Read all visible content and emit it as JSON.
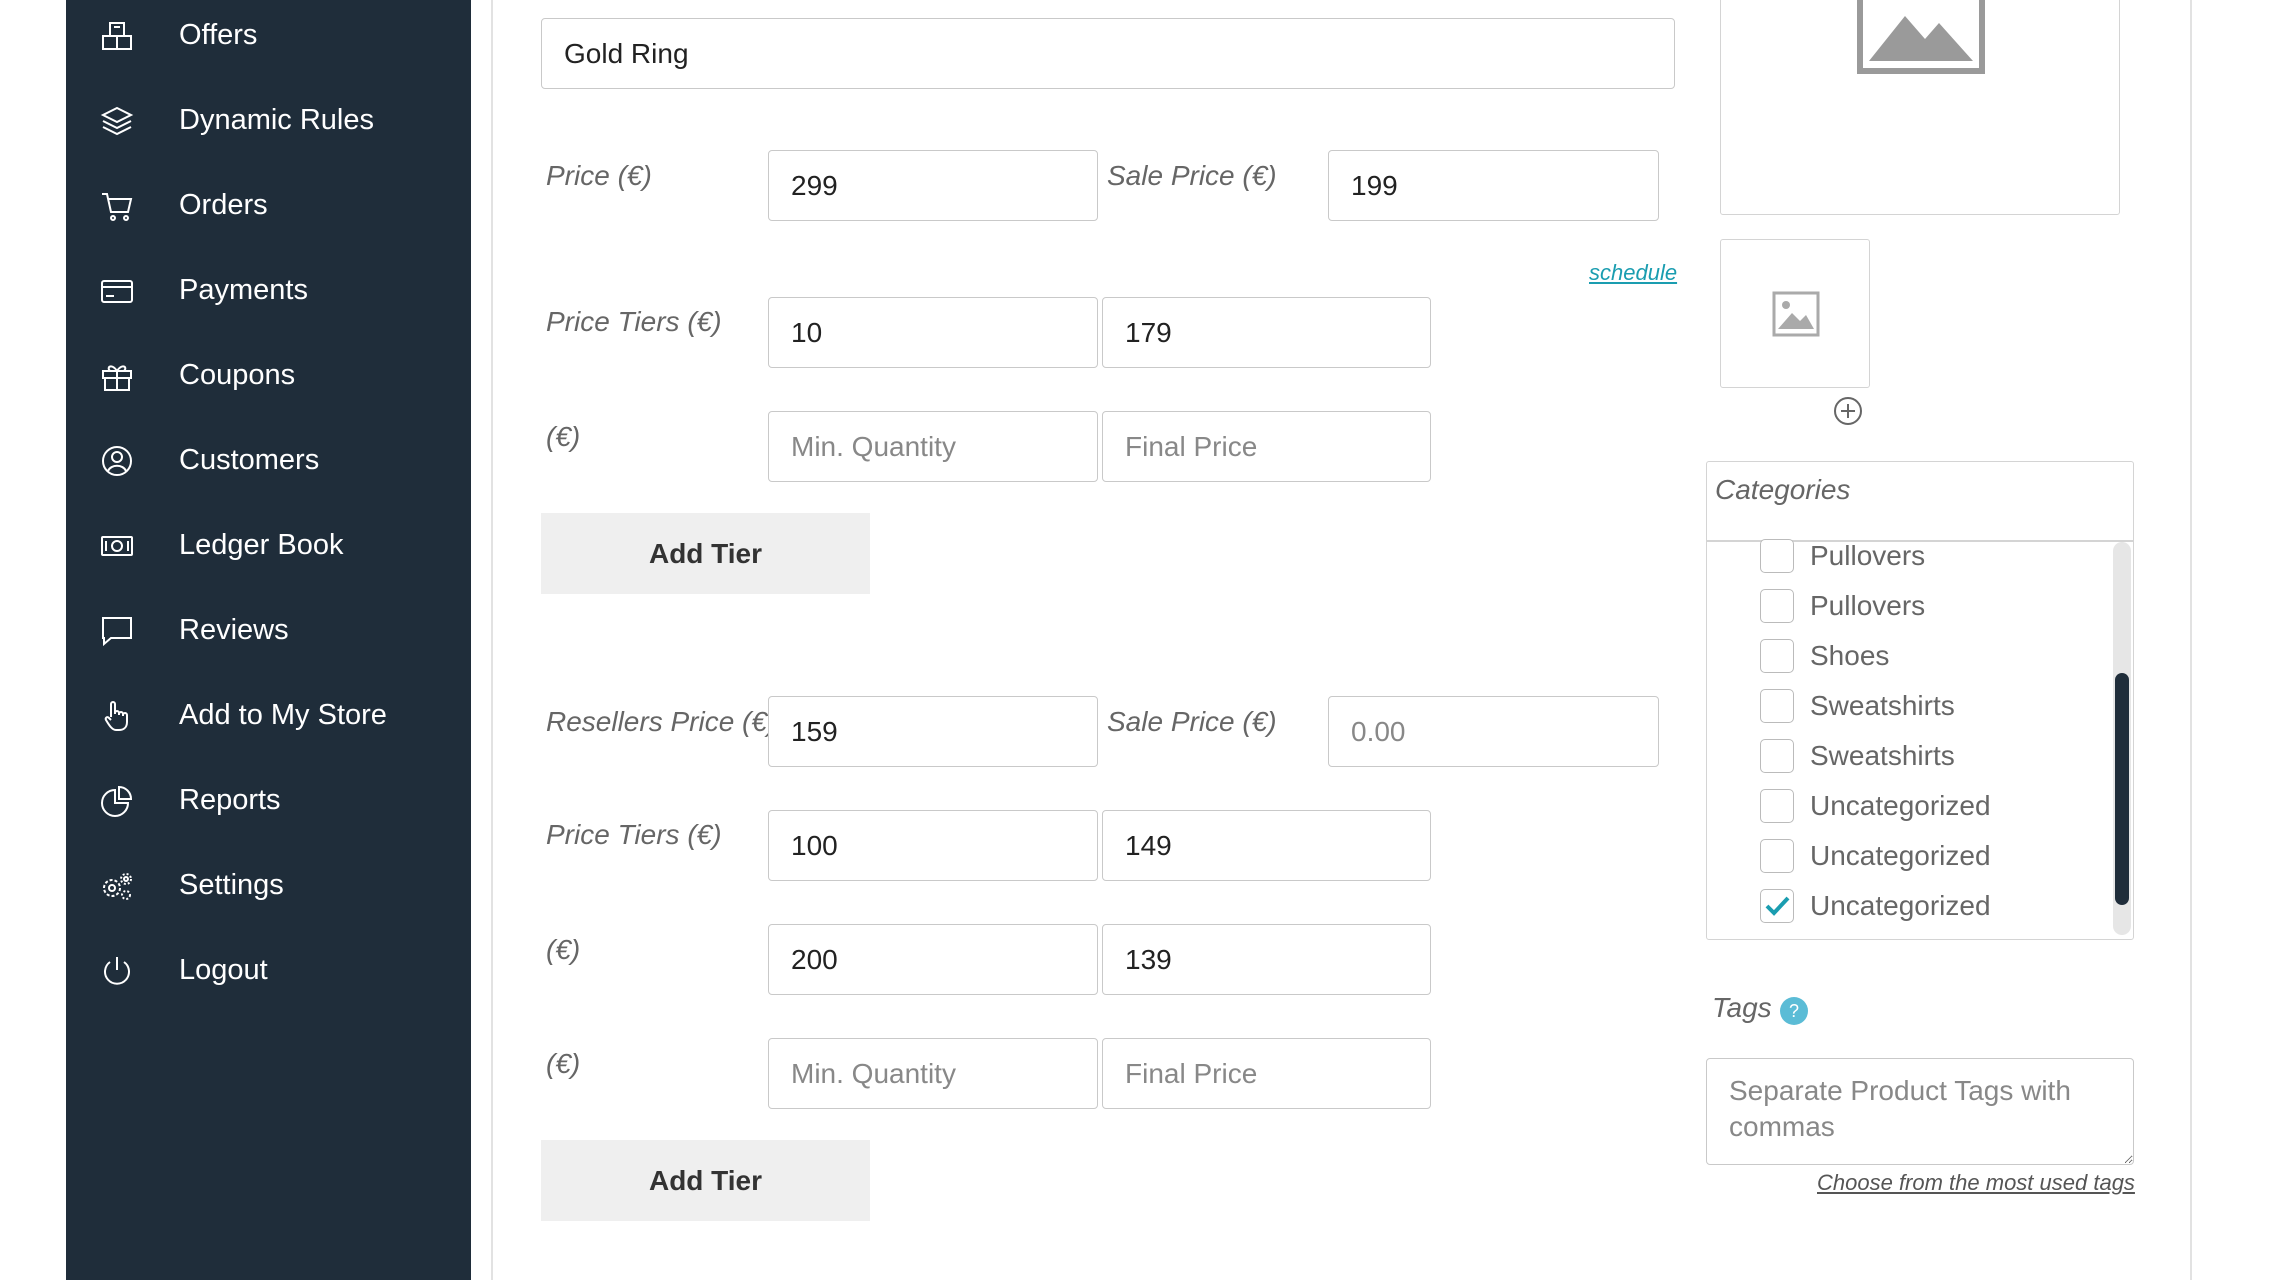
{
  "sidebar": {
    "items": [
      {
        "label": "Offers",
        "icon": "offers-icon"
      },
      {
        "label": "Dynamic Rules",
        "icon": "layers-icon"
      },
      {
        "label": "Orders",
        "icon": "cart-icon"
      },
      {
        "label": "Payments",
        "icon": "credit-card-icon"
      },
      {
        "label": "Coupons",
        "icon": "gift-icon"
      },
      {
        "label": "Customers",
        "icon": "user-circle-icon"
      },
      {
        "label": "Ledger Book",
        "icon": "money-icon"
      },
      {
        "label": "Reviews",
        "icon": "chat-bubble-icon"
      },
      {
        "label": "Add to My Store",
        "icon": "hand-pointer-icon"
      },
      {
        "label": "Reports",
        "icon": "pie-chart-icon"
      },
      {
        "label": "Settings",
        "icon": "gears-icon"
      },
      {
        "label": "Logout",
        "icon": "power-icon"
      }
    ]
  },
  "product": {
    "name": "Gold Ring"
  },
  "pricing": {
    "price_label": "Price (€)",
    "price_value": "299",
    "sale_price_label": "Sale Price (€)",
    "sale_price_value": "199",
    "schedule_link": "schedule",
    "tiers_label": "Price Tiers (€)",
    "tier_unit_label": "(€)",
    "tiers": [
      {
        "min_qty": "10",
        "final_price": "179"
      }
    ],
    "new_tier_placeholders": {
      "min_qty": "Min. Quantity",
      "final_price": "Final Price"
    },
    "add_tier_label": "Add Tier"
  },
  "reseller": {
    "price_label": "Resellers Price (€)",
    "price_value": "159",
    "sale_price_label": "Sale Price (€)",
    "sale_price_placeholder": "0.00",
    "tiers_label": "Price Tiers (€)",
    "tier_unit_label": "(€)",
    "tiers": [
      {
        "min_qty": "100",
        "final_price": "149"
      },
      {
        "min_qty": "200",
        "final_price": "139"
      }
    ],
    "new_tier_placeholders": {
      "min_qty": "Min. Quantity",
      "final_price": "Final Price"
    },
    "add_tier_label": "Add Tier"
  },
  "categories": {
    "title": "Categories",
    "items": [
      {
        "label": "Pullovers",
        "checked": false
      },
      {
        "label": "Pullovers",
        "checked": false
      },
      {
        "label": "Shoes",
        "checked": false
      },
      {
        "label": "Sweatshirts",
        "checked": false
      },
      {
        "label": "Sweatshirts",
        "checked": false
      },
      {
        "label": "Uncategorized",
        "checked": false
      },
      {
        "label": "Uncategorized",
        "checked": false
      },
      {
        "label": "Uncategorized",
        "checked": true
      }
    ]
  },
  "tags": {
    "title": "Tags",
    "placeholder": "Separate Product Tags with commas",
    "choose_link": "Choose from the most used tags"
  },
  "colors": {
    "sidebar_bg": "#1f2d3a",
    "accent": "#1a9db0",
    "help_badge": "#5bbcd6"
  }
}
